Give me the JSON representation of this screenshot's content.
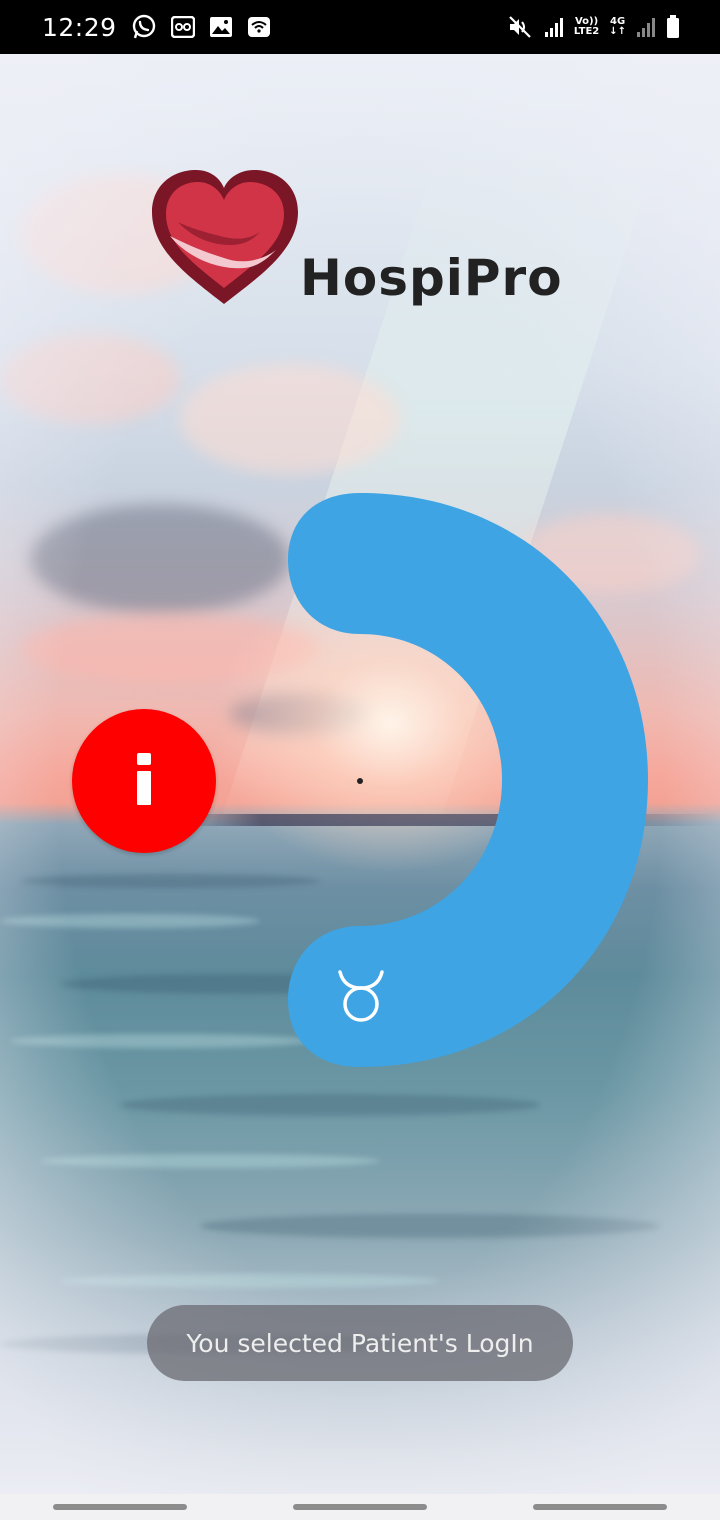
{
  "status_bar": {
    "time": "12:29",
    "left_icons": [
      "whatsapp-icon",
      "voicemail-icon",
      "image-icon",
      "wifi-icon"
    ],
    "right_icons": [
      "mute-icon",
      "signal-icon",
      "volte-icon",
      "4g-icon",
      "signal-icon",
      "battery-icon"
    ],
    "volte_top": "Vo))",
    "volte_bottom": "LTE2",
    "network_label": "4G"
  },
  "app": {
    "name": "HospiPro",
    "logo_icon": "heart-hand-icon",
    "brand_colors": {
      "heart": "#c8203a",
      "heart_dark": "#7a1626",
      "arc": "#3ea4e4",
      "info": "#ff0000"
    }
  },
  "arc_menu": {
    "icon": "taurus-symbol-icon",
    "glyph": "♉"
  },
  "info_button": {
    "icon": "info-icon",
    "glyph": "i"
  },
  "toast": {
    "message": "You selected Patient's LogIn"
  },
  "nav_bar": {
    "buttons": [
      "recents",
      "home",
      "back"
    ]
  }
}
